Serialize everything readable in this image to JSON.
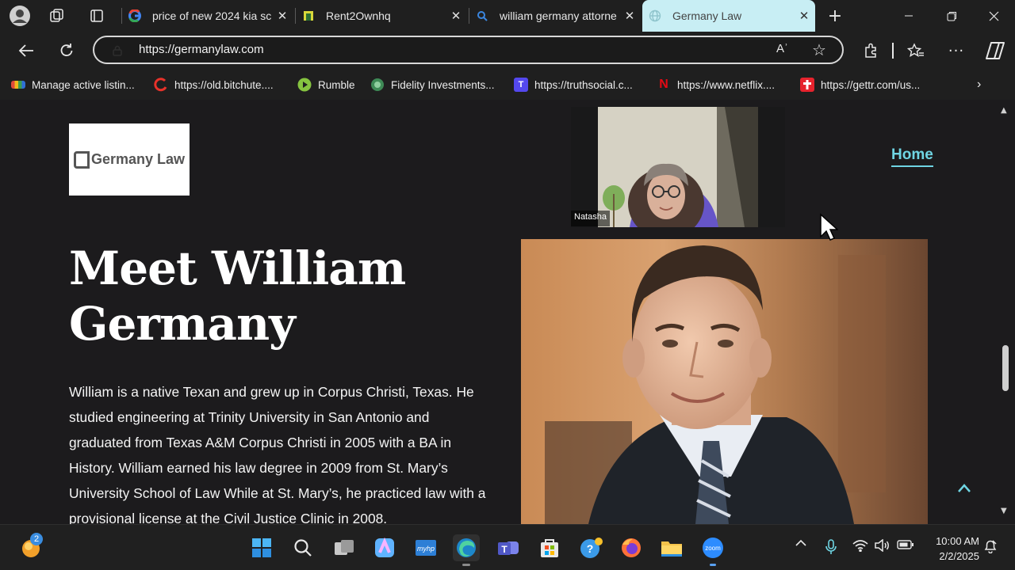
{
  "browser": {
    "tabs": [
      {
        "title": "price of new 2024 kia sc",
        "icon": "google-icon"
      },
      {
        "title": "Rent2Ownhq",
        "icon": "rent2own-icon"
      },
      {
        "title": "william germany attorne",
        "icon": "search-icon"
      },
      {
        "title": "Germany Law",
        "icon": "globe-icon",
        "active": true
      }
    ],
    "url": "https://germanylaw.com",
    "read_aloud_label": "Aʾ"
  },
  "bookmarks": [
    {
      "label": "Manage active listin...",
      "color": "#e04a3a"
    },
    {
      "label": "https://old.bitchute....",
      "color": "#e8322a"
    },
    {
      "label": "Rumble",
      "color": "#86c440"
    },
    {
      "label": "Fidelity Investments...",
      "color": "#3e8a56"
    },
    {
      "label": "https://truthsocial.c...",
      "color": "#5448ee"
    },
    {
      "label": "https://www.netflix....",
      "color": "#e50914"
    },
    {
      "label": "https://gettr.com/us...",
      "color": "#e6232d"
    }
  ],
  "page": {
    "logo_text": "Germany Law",
    "nav_home": "Home",
    "title": "Meet William Germany",
    "bio": "William is a native Texan and grew up in Corpus Christi, Texas. He studied engineering at Trinity University in San Antonio and graduated from Texas A&M Corpus Christi in 2005 with a BA in History. William earned his law degree in 2009 from St. Mary’s University School of Law While at St. Mary’s, he practiced law with a provisional license at the Civil Justice Clinic in 2008."
  },
  "video_call": {
    "participant_name": "Natasha"
  },
  "taskbar": {
    "widget_badge": "2",
    "clock_time": "10:00 AM",
    "clock_date": "2/2/2025"
  },
  "colors": {
    "accent": "#6fd5e3",
    "active_tab": "#c8eef4",
    "page_bg": "#1c1b1d"
  }
}
